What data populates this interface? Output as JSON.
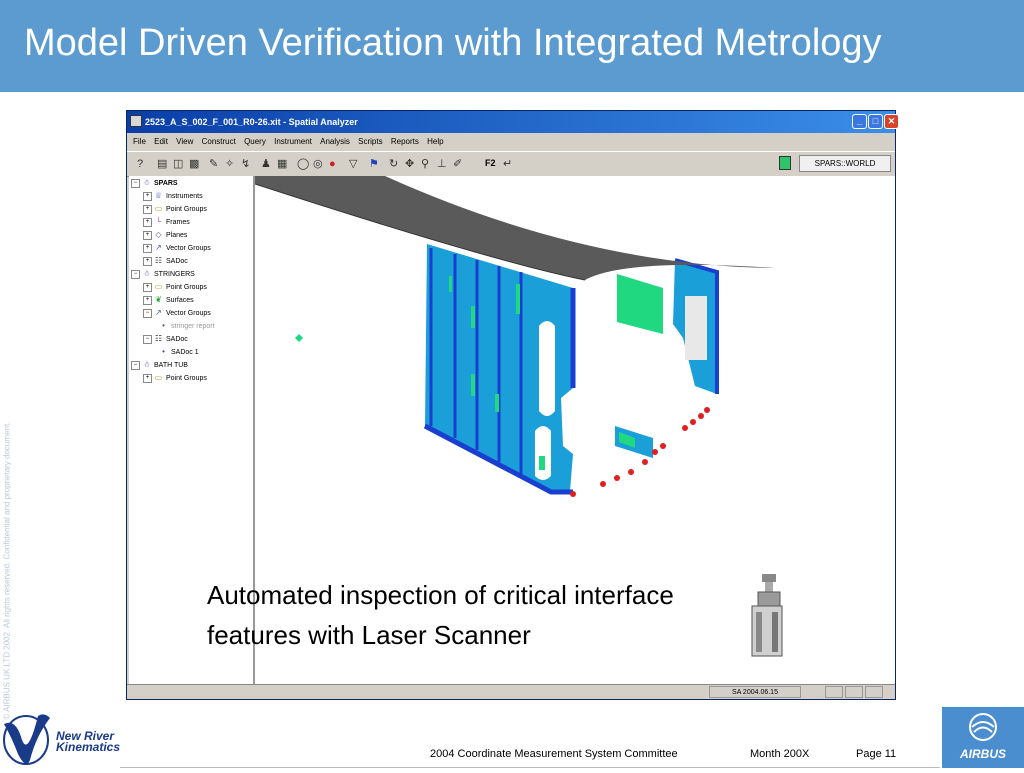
{
  "slide": {
    "title": "Model Driven Verification with Integrated Metrology",
    "side_text": "© AIRBUS UK LTD 2002. All rights reserved. Confidential and proprietary document.",
    "caption": "Automated inspection of critical interface features with Laser Scanner"
  },
  "window": {
    "title": "2523_A_S_002_F_001_R0-26.xit - Spatial Analyzer",
    "minimize": "_",
    "maximize": "□",
    "close": "✕"
  },
  "menu": [
    "File",
    "Edit",
    "View",
    "Construct",
    "Query",
    "Instrument",
    "Analysis",
    "Scripts",
    "Reports",
    "Help"
  ],
  "toolbar": {
    "f2_label": "F2",
    "frame": "SPARS::WORLD"
  },
  "tree": [
    {
      "label": "SPARS",
      "icon": "collection-icon",
      "glyph": "☃",
      "exp": "−"
    },
    {
      "label": "Instruments",
      "icon": "instrument-icon",
      "glyph": "♕",
      "exp": "+"
    },
    {
      "label": "Point Groups",
      "icon": "folder-icon",
      "glyph": "▭",
      "exp": "+"
    },
    {
      "label": "Frames",
      "icon": "frame-icon",
      "glyph": "└",
      "exp": "+"
    },
    {
      "label": "Planes",
      "icon": "plane-icon",
      "glyph": "◇",
      "exp": "+"
    },
    {
      "label": "Vector Groups",
      "icon": "vector-icon",
      "glyph": "↗",
      "exp": "+"
    },
    {
      "label": "SADoc",
      "icon": "document-icon",
      "glyph": "☷",
      "exp": "+"
    },
    {
      "label": "STRINGERS",
      "icon": "collection-icon",
      "glyph": "☃",
      "exp": "−"
    },
    {
      "label": "Point Groups",
      "icon": "folder-icon",
      "glyph": "▭",
      "exp": "+"
    },
    {
      "label": "Surfaces",
      "icon": "surface-icon",
      "glyph": "❦",
      "exp": "+"
    },
    {
      "label": "Vector Groups",
      "icon": "vector-icon",
      "glyph": "↗",
      "exp": "−"
    },
    {
      "label": "stringer report",
      "icon": "bullet-icon",
      "glyph": "•",
      "exp": ""
    },
    {
      "label": "SADoc",
      "icon": "document-icon",
      "glyph": "☷",
      "exp": "−"
    },
    {
      "label": "SADoc 1",
      "icon": "bullet-icon",
      "glyph": "•",
      "exp": ""
    },
    {
      "label": "BATH TUB",
      "icon": "collection-icon",
      "glyph": "☃",
      "exp": "−"
    },
    {
      "label": "Point Groups",
      "icon": "folder-icon",
      "glyph": "▭",
      "exp": "+"
    }
  ],
  "status": {
    "version": "SA 2004.06.15"
  },
  "footer": {
    "company_line1": "New River",
    "company_line2": "Kinematics",
    "conference": "2004 Coordinate Measurement System Committee",
    "date": "Month 200X",
    "page": "Page 11",
    "airbus": "AIRBUS"
  },
  "colors": {
    "title_bar": "#5b9bd0",
    "scan_cyan": "#1a9fd8",
    "scan_blue": "#1a3fd0",
    "scan_green": "#20d880",
    "target_red": "#e02020",
    "surface_grey": "#5a5a5a"
  }
}
